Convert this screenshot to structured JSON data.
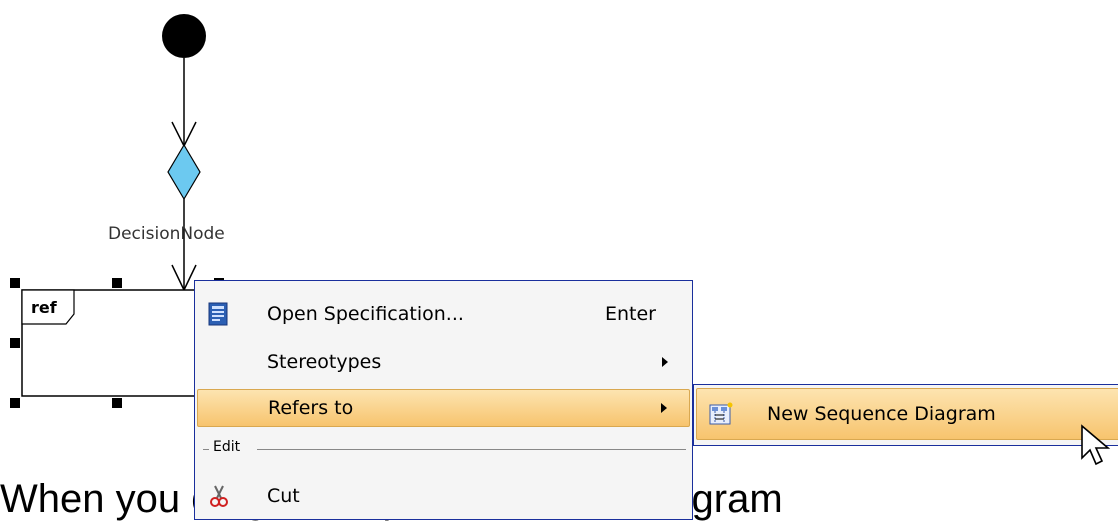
{
  "diagram": {
    "decision_label": "DecisionNode",
    "ref_label": "ref",
    "colors": {
      "decision_fill": "#6cc9f0",
      "node_fill": "#000000"
    }
  },
  "context_menu": {
    "items": [
      {
        "label": "Open Specification...",
        "shortcut": "Enter",
        "icon": "specification-icon"
      },
      {
        "label": "Stereotypes",
        "submenu": true
      },
      {
        "label": "Refers to",
        "submenu": true,
        "highlighted": true
      }
    ],
    "group_header": "Edit",
    "edit_items": [
      {
        "label": "Cut",
        "icon": "scissors-icon"
      }
    ]
  },
  "submenu": {
    "items": [
      {
        "label": "New Sequence Diagram",
        "icon": "sequence-diagram-icon",
        "highlighted": true
      }
    ]
  },
  "caption": {
    "text": "When you    diagram represented    the diagram"
  },
  "colors": {
    "menu_border": "#1a2f9c",
    "highlight": "#f7c46e"
  }
}
